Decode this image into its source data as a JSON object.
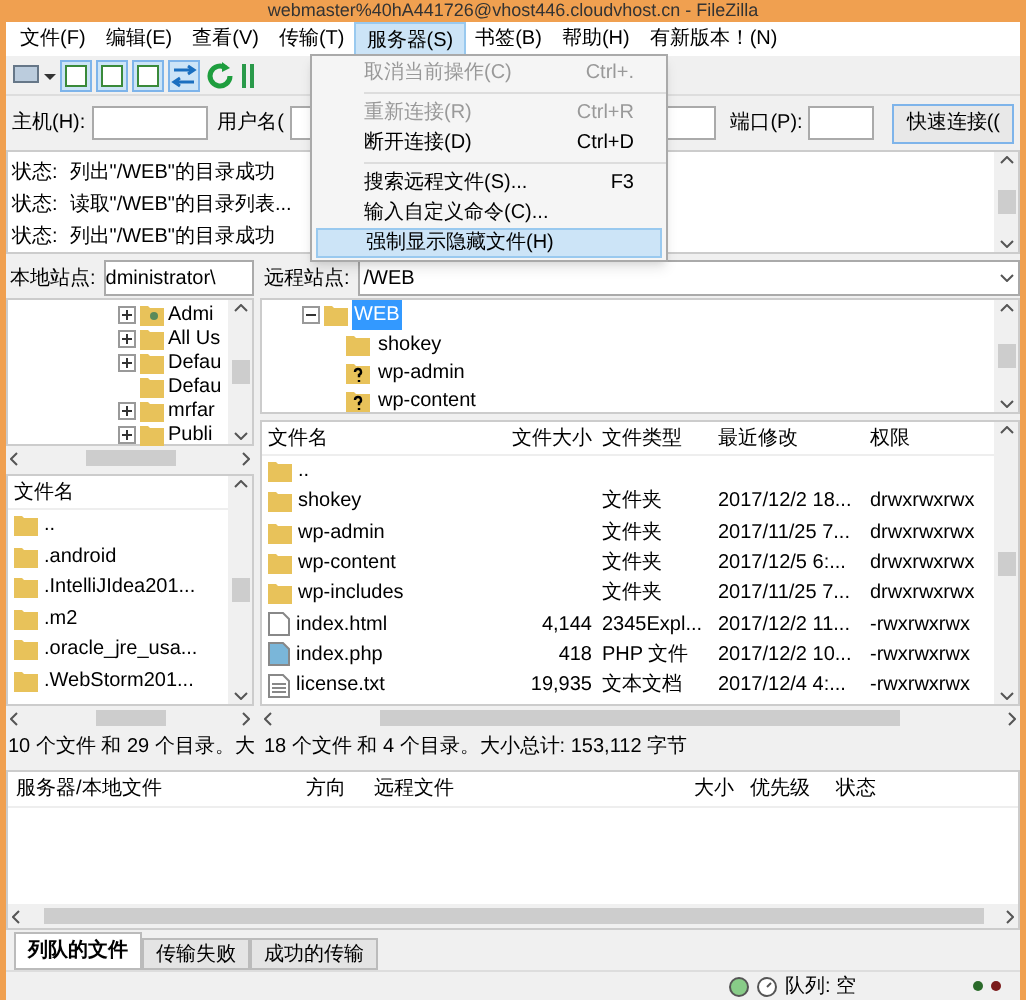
{
  "window": {
    "title": "webmaster%40hA441726@vhost446.cloudvhost.cn - FileZilla"
  },
  "menubar": [
    {
      "label": "文件(F)",
      "selected": false
    },
    {
      "label": "编辑(E)",
      "selected": false
    },
    {
      "label": "查看(V)",
      "selected": false
    },
    {
      "label": "传输(T)",
      "selected": false
    },
    {
      "label": "服务器(S)",
      "selected": true
    },
    {
      "label": "书签(B)",
      "selected": false
    },
    {
      "label": "帮助(H)",
      "selected": false
    },
    {
      "label": "有新版本！(N)",
      "selected": false
    }
  ],
  "menu": [
    {
      "kind": "item",
      "label": "取消当前操作(C)",
      "shortcut": "Ctrl+.",
      "disabled": true,
      "selected": false
    },
    {
      "kind": "separator"
    },
    {
      "kind": "item",
      "label": "重新连接(R)",
      "shortcut": "Ctrl+R",
      "disabled": true,
      "selected": false
    },
    {
      "kind": "item",
      "label": "断开连接(D)",
      "shortcut": "Ctrl+D",
      "disabled": false,
      "selected": false
    },
    {
      "kind": "separator"
    },
    {
      "kind": "item",
      "label": "搜索远程文件(S)...",
      "shortcut": "F3",
      "disabled": false,
      "selected": false
    },
    {
      "kind": "item",
      "label": "输入自定义命令(C)...",
      "disabled": false,
      "selected": false
    },
    {
      "kind": "item",
      "label": "强制显示隐藏文件(H)",
      "disabled": false,
      "selected": true
    }
  ],
  "quickconnect": {
    "host_label": "主机(H):",
    "user_label": "用户名(",
    "port_label": "端口(P):",
    "button": "快速连接(("
  },
  "log": [
    {
      "label": "状态:",
      "text": "列出\"/WEB\"的目录成功"
    },
    {
      "label": "状态:",
      "text": "读取\"/WEB\"的目录列表..."
    },
    {
      "label": "状态:",
      "text": "列出\"/WEB\"的目录成功"
    }
  ],
  "local": {
    "site_label": "本地站点:",
    "path": "dministrator\\",
    "tree": [
      {
        "name": "Admi",
        "kind": "user"
      },
      {
        "name": "All Us",
        "kind": "folder"
      },
      {
        "name": "Defau",
        "kind": "folder"
      },
      {
        "name": "Defau",
        "kind": "leaf"
      },
      {
        "name": "mrfar",
        "kind": "folder"
      },
      {
        "name": "Publi",
        "kind": "folder"
      }
    ],
    "columns": [
      "文件名"
    ],
    "files": [
      {
        "name": ".."
      },
      {
        "name": ".android"
      },
      {
        "name": ".IntelliJIdea201..."
      },
      {
        "name": ".m2"
      },
      {
        "name": ".oracle_jre_usa..."
      },
      {
        "name": ".WebStorm201..."
      }
    ],
    "status": "10 个文件 和 29 个目录。大"
  },
  "remote": {
    "site_label": "远程站点:",
    "path": "/WEB",
    "tree": [
      {
        "name": "WEB",
        "selected": true,
        "expanded": true,
        "children": [
          {
            "name": "shokey",
            "kind": "folder"
          },
          {
            "name": "wp-admin",
            "kind": "unknown"
          },
          {
            "name": "wp-content",
            "kind": "unknown"
          }
        ]
      }
    ],
    "columns": [
      "文件名",
      "文件大小",
      "文件类型",
      "最近修改",
      "权限"
    ],
    "files": [
      {
        "kind": "folder",
        "name": ".."
      },
      {
        "kind": "folder",
        "name": "shokey",
        "type": "文件夹",
        "modified": "2017/12/2 18...",
        "permissions": "drwxrwxrwx"
      },
      {
        "kind": "folder",
        "name": "wp-admin",
        "type": "文件夹",
        "modified": "2017/11/25 7...",
        "permissions": "drwxrwxrwx"
      },
      {
        "kind": "folder",
        "name": "wp-content",
        "type": "文件夹",
        "modified": "2017/12/5 6:...",
        "permissions": "drwxrwxrwx"
      },
      {
        "kind": "folder",
        "name": "wp-includes",
        "type": "文件夹",
        "modified": "2017/11/25 7...",
        "permissions": "drwxrwxrwx"
      },
      {
        "kind": "file",
        "name": "index.html",
        "size": "4,144",
        "type": "2345Expl...",
        "modified": "2017/12/2 11...",
        "permissions": "-rwxrwxrwx"
      },
      {
        "kind": "php",
        "name": "index.php",
        "size": "418",
        "type": "PHP 文件",
        "modified": "2017/12/2 10...",
        "permissions": "-rwxrwxrwx"
      },
      {
        "kind": "text",
        "name": "license.txt",
        "size": "19,935",
        "type": "文本文档",
        "modified": "2017/12/4 4:...",
        "permissions": "-rwxrwxrwx"
      }
    ],
    "status": "18 个文件 和 4 个目录。大小总计: 153,112 字节"
  },
  "queue": {
    "columns": [
      "服务器/本地文件",
      "方向",
      "远程文件",
      "大小",
      "优先级",
      "状态"
    ]
  },
  "tabs": [
    {
      "label": "列队的文件",
      "selected": true
    },
    {
      "label": "传输失败",
      "selected": false
    },
    {
      "label": "成功的传输",
      "selected": false
    }
  ],
  "status_bar": {
    "queue": "队列: 空"
  }
}
